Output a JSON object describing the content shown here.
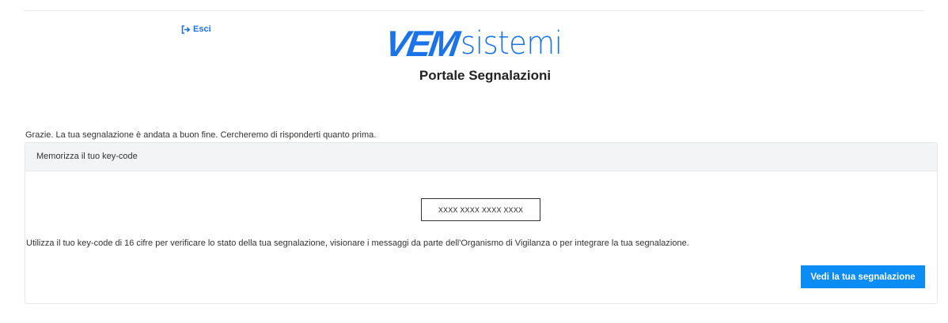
{
  "header": {
    "logout_label": "Esci",
    "logout_icon": "sign-out-icon",
    "brand_mark": "VEM",
    "brand_word": "sistemi",
    "portal_title": "Portale Segnalazioni"
  },
  "main": {
    "confirmation_message": "Grazie. La tua segnalazione è andata a buon fine. Cercheremo di risponderti quanto prima.",
    "panel": {
      "header": "Memorizza il tuo key-code",
      "keycode_value": "XXXX XXXX XXXX XXXX",
      "info_message": "Utilizza il tuo key-code di 16 cifre per verificare lo stato della tua segnalazione, visionare i messaggi da parte dell'Organismo di Vigilanza o per integrare la tua segnalazione.",
      "view_button_label": "Vedi la tua segnalazione"
    }
  },
  "colors": {
    "accent": "#1a73e8",
    "button": "#0b8df5",
    "panel_header_bg": "#f3f4f6"
  }
}
